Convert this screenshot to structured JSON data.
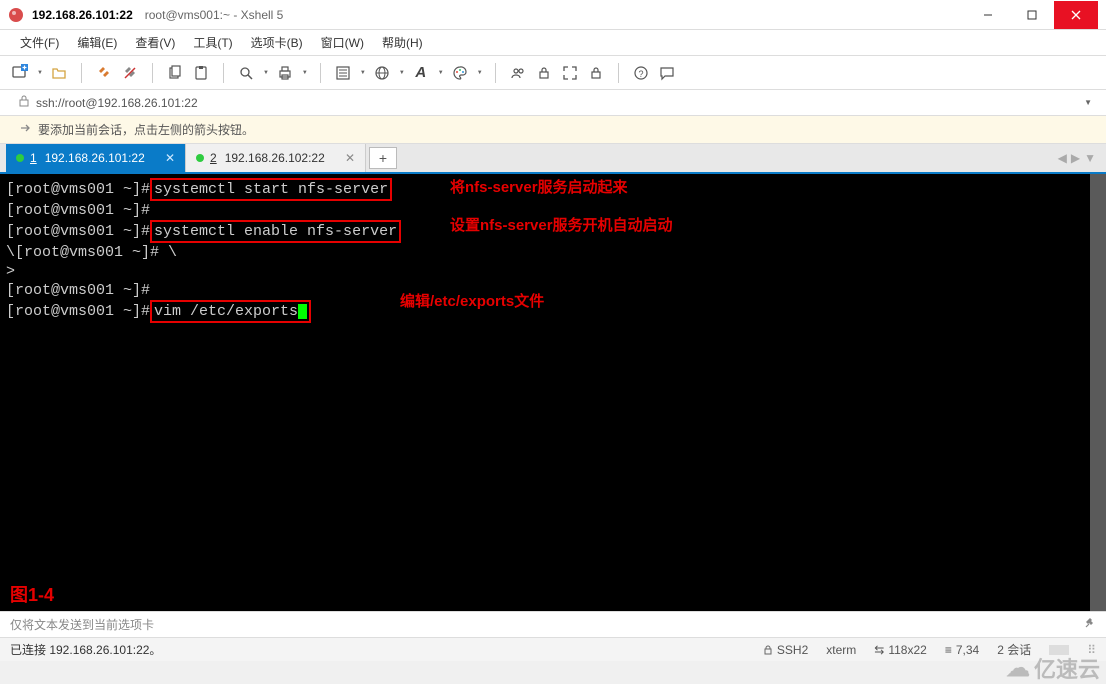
{
  "window": {
    "title": "192.168.26.101:22",
    "subtitle": "root@vms001:~ - Xshell 5"
  },
  "menu": {
    "file": "文件(F)",
    "edit": "编辑(E)",
    "view": "查看(V)",
    "tools": "工具(T)",
    "tabs": "选项卡(B)",
    "window": "窗口(W)",
    "help": "帮助(H)"
  },
  "address": "ssh://root@192.168.26.101:22",
  "hint": "要添加当前会话，点击左侧的箭头按钮。",
  "tablist": [
    {
      "num": "1",
      "label": "192.168.26.101:22",
      "active": true
    },
    {
      "num": "2",
      "label": "192.168.26.102:22",
      "active": false
    }
  ],
  "term": {
    "ps1": "[root@vms001 ~]#",
    "ps1_esc": "\\[root@vms001 ~]# \\",
    "gt": ">",
    "cmd1": "systemctl start nfs-server",
    "note1": "将nfs-server服务启动起来",
    "cmd2": "systemctl enable nfs-server",
    "note2": "设置nfs-server服务开机自动启动",
    "cmd3": "vim /etc/exports",
    "note3": "编辑/etc/exports文件",
    "fig": "图1-4"
  },
  "send_placeholder": "仅将文本发送到当前选项卡",
  "status": {
    "conn": "已连接 192.168.26.101:22。",
    "proto": "SSH2",
    "termtype": "xterm",
    "size": "118x22",
    "cursor": "7,34",
    "sessions": "2 会话"
  },
  "watermark": "亿速云"
}
